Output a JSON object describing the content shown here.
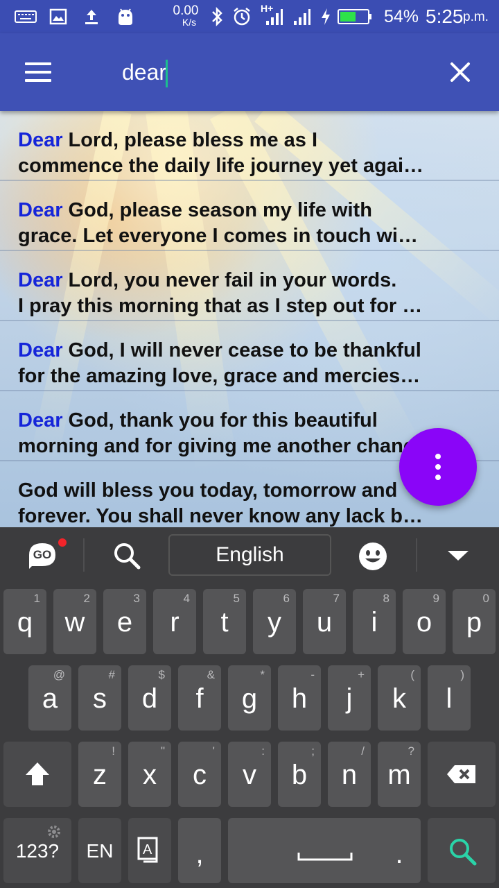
{
  "status_bar": {
    "network_speed_value": "0.00",
    "network_speed_unit": "K/s",
    "network_type": "H+",
    "battery_percent": "54%",
    "time": "5:25",
    "time_suffix": "p.m."
  },
  "toolbar": {
    "search_query": "dear"
  },
  "results": [
    {
      "keyword": "Dear",
      "line1_rest": " Lord, please bless me as I",
      "line2": "commence the daily life journey yet agai…"
    },
    {
      "keyword": "Dear",
      "line1_rest": " God, please season my life with",
      "line2": "grace. Let everyone I comes in touch wi…"
    },
    {
      "keyword": "Dear",
      "line1_rest": " Lord, you never fail in your words.",
      "line2": "I pray this morning that as I step out for …"
    },
    {
      "keyword": "Dear",
      "line1_rest": " God, I will never cease to be thankful",
      "line2": "for the amazing love, grace and mercies…"
    },
    {
      "keyword": "Dear",
      "line1_rest": " God, thank you for this beautiful",
      "line2": "morning and for giving me another chance"
    },
    {
      "keyword": "",
      "line1_rest": "God will bless you today, tomorrow and",
      "line2": "forever. You shall never know any lack b…"
    }
  ],
  "keyboard": {
    "logo_label": "GO",
    "language": "English",
    "row1": [
      {
        "key": "q",
        "hint": "1"
      },
      {
        "key": "w",
        "hint": "2"
      },
      {
        "key": "e",
        "hint": "3"
      },
      {
        "key": "r",
        "hint": "4"
      },
      {
        "key": "t",
        "hint": "5"
      },
      {
        "key": "y",
        "hint": "6"
      },
      {
        "key": "u",
        "hint": "7"
      },
      {
        "key": "i",
        "hint": "8"
      },
      {
        "key": "o",
        "hint": "9"
      },
      {
        "key": "p",
        "hint": "0"
      }
    ],
    "row2": [
      {
        "key": "a",
        "hint": "@"
      },
      {
        "key": "s",
        "hint": "#"
      },
      {
        "key": "d",
        "hint": "$"
      },
      {
        "key": "f",
        "hint": "&"
      },
      {
        "key": "g",
        "hint": "*"
      },
      {
        "key": "h",
        "hint": "-"
      },
      {
        "key": "j",
        "hint": "+"
      },
      {
        "key": "k",
        "hint": "("
      },
      {
        "key": "l",
        "hint": ")"
      }
    ],
    "row3": [
      {
        "key": "z",
        "hint": "!"
      },
      {
        "key": "x",
        "hint": "\""
      },
      {
        "key": "c",
        "hint": "'"
      },
      {
        "key": "v",
        "hint": ":"
      },
      {
        "key": "b",
        "hint": ";"
      },
      {
        "key": "n",
        "hint": "/"
      },
      {
        "key": "m",
        "hint": "?"
      }
    ],
    "symbols_label": "123?",
    "lang_key_label": "EN",
    "comma_label": ",",
    "period_label": ".",
    "accent_color": "#2ad4a8",
    "fab_color": "#8a05f8"
  }
}
